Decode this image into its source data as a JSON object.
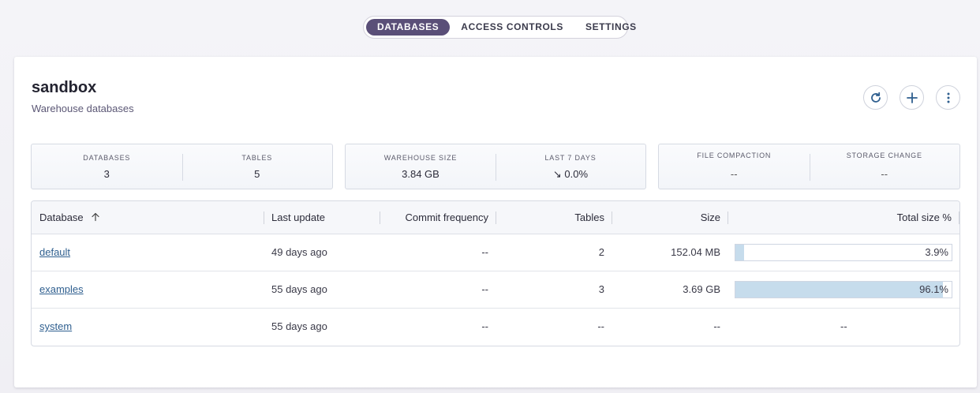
{
  "tabs": [
    {
      "label": "DATABASES",
      "active": true
    },
    {
      "label": "ACCESS CONTROLS",
      "active": false
    },
    {
      "label": "SETTINGS",
      "active": false
    }
  ],
  "header": {
    "title": "sandbox",
    "subtitle": "Warehouse databases",
    "actions": [
      "refresh-icon",
      "plus-icon",
      "more-vertical-icon"
    ]
  },
  "stats": [
    {
      "left": {
        "label": "DATABASES",
        "value": "3"
      },
      "right": {
        "label": "TABLES",
        "value": "5"
      }
    },
    {
      "left": {
        "label": "WAREHOUSE SIZE",
        "value": "3.84 GB"
      },
      "right": {
        "label": "LAST 7 DAYS",
        "value": "↘ 0.0%"
      }
    },
    {
      "left": {
        "label": "FILE COMPACTION",
        "value": "--"
      },
      "right": {
        "label": "STORAGE CHANGE",
        "value": "--"
      }
    }
  ],
  "table": {
    "columns": [
      "Database",
      "Last update",
      "Commit frequency",
      "Tables",
      "Size",
      "Total size %"
    ],
    "sort_icon": "arrow-up-icon",
    "rows": [
      {
        "database": "default",
        "last_update": "49 days ago",
        "commit_frequency": "--",
        "tables": "2",
        "size": "152.04 MB",
        "total_pct_label": "3.9%",
        "total_pct": 3.9
      },
      {
        "database": "examples",
        "last_update": "55 days ago",
        "commit_frequency": "--",
        "tables": "3",
        "size": "3.69 GB",
        "total_pct_label": "96.1%",
        "total_pct": 96.1
      },
      {
        "database": "system",
        "last_update": "55 days ago",
        "commit_frequency": "--",
        "tables": "--",
        "size": "--",
        "total_pct_label": "--",
        "total_pct": null
      }
    ]
  },
  "colors": {
    "accent": "#5a4f78",
    "link": "#2f5f8f",
    "bar_fill": "#c6dcec"
  }
}
